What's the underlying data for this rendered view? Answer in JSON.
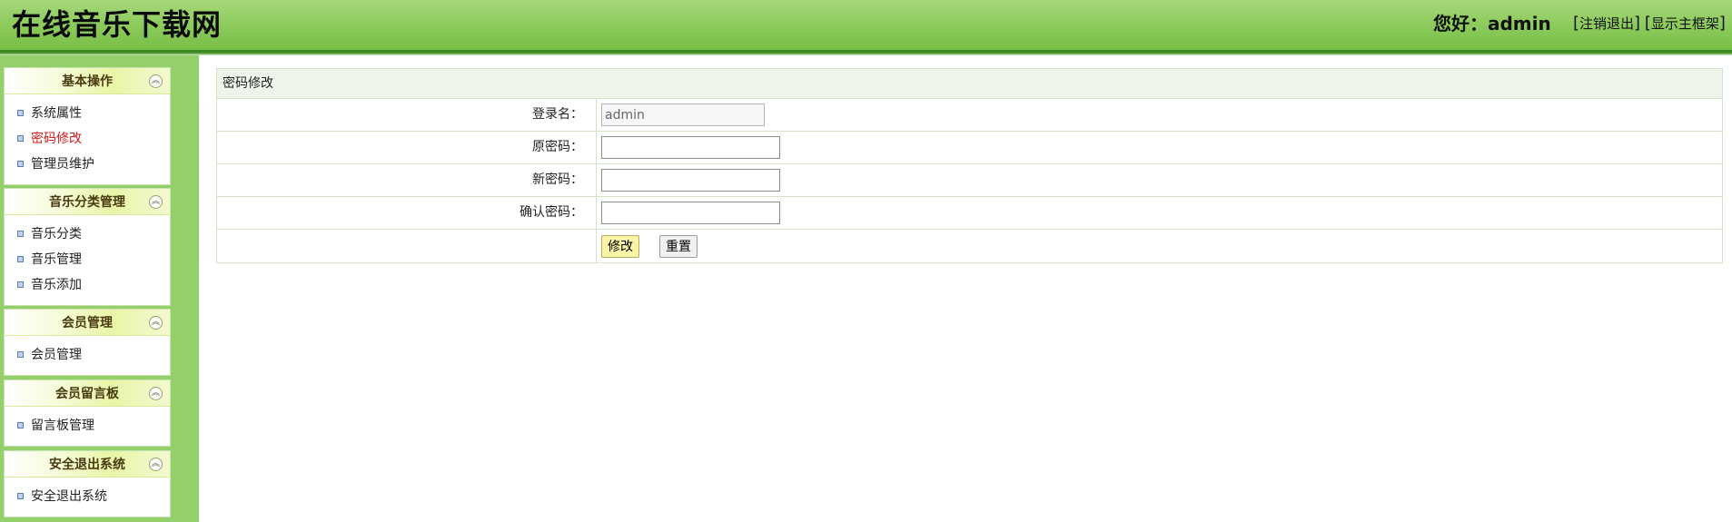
{
  "header": {
    "site_title": "在线音乐下载网",
    "greeting": "您好：admin",
    "logout_link": "注销退出",
    "show_frame_link": "显示主框架"
  },
  "sidebar": {
    "panels": [
      {
        "title": "基本操作",
        "items": [
          "系统属性",
          "密码修改",
          "管理员维护"
        ]
      },
      {
        "title": "音乐分类管理",
        "items": [
          "音乐分类",
          "音乐管理",
          "音乐添加"
        ]
      },
      {
        "title": "会员管理",
        "items": [
          "会员管理"
        ]
      },
      {
        "title": "会员留言板",
        "items": [
          "留言板管理"
        ]
      },
      {
        "title": "安全退出系统",
        "items": [
          "安全退出系统"
        ]
      }
    ],
    "active_item": "密码修改",
    "collapse_icon": "chevron-double-up-icon",
    "bullet_icon": "square-bullet-icon"
  },
  "form": {
    "caption": "密码修改",
    "rows": [
      {
        "label": "登录名：",
        "value": "admin"
      },
      {
        "label": "原密码：",
        "value": ""
      },
      {
        "label": "新密码：",
        "value": ""
      },
      {
        "label": "确认密码：",
        "value": ""
      }
    ],
    "submit_label": "修改",
    "reset_label": "重置"
  },
  "colors": {
    "header_green": "#8ccb5c",
    "sidebar_green": "#94cf6a",
    "active_red": "#d21818",
    "submit_yellow": "#f8f3a5"
  }
}
